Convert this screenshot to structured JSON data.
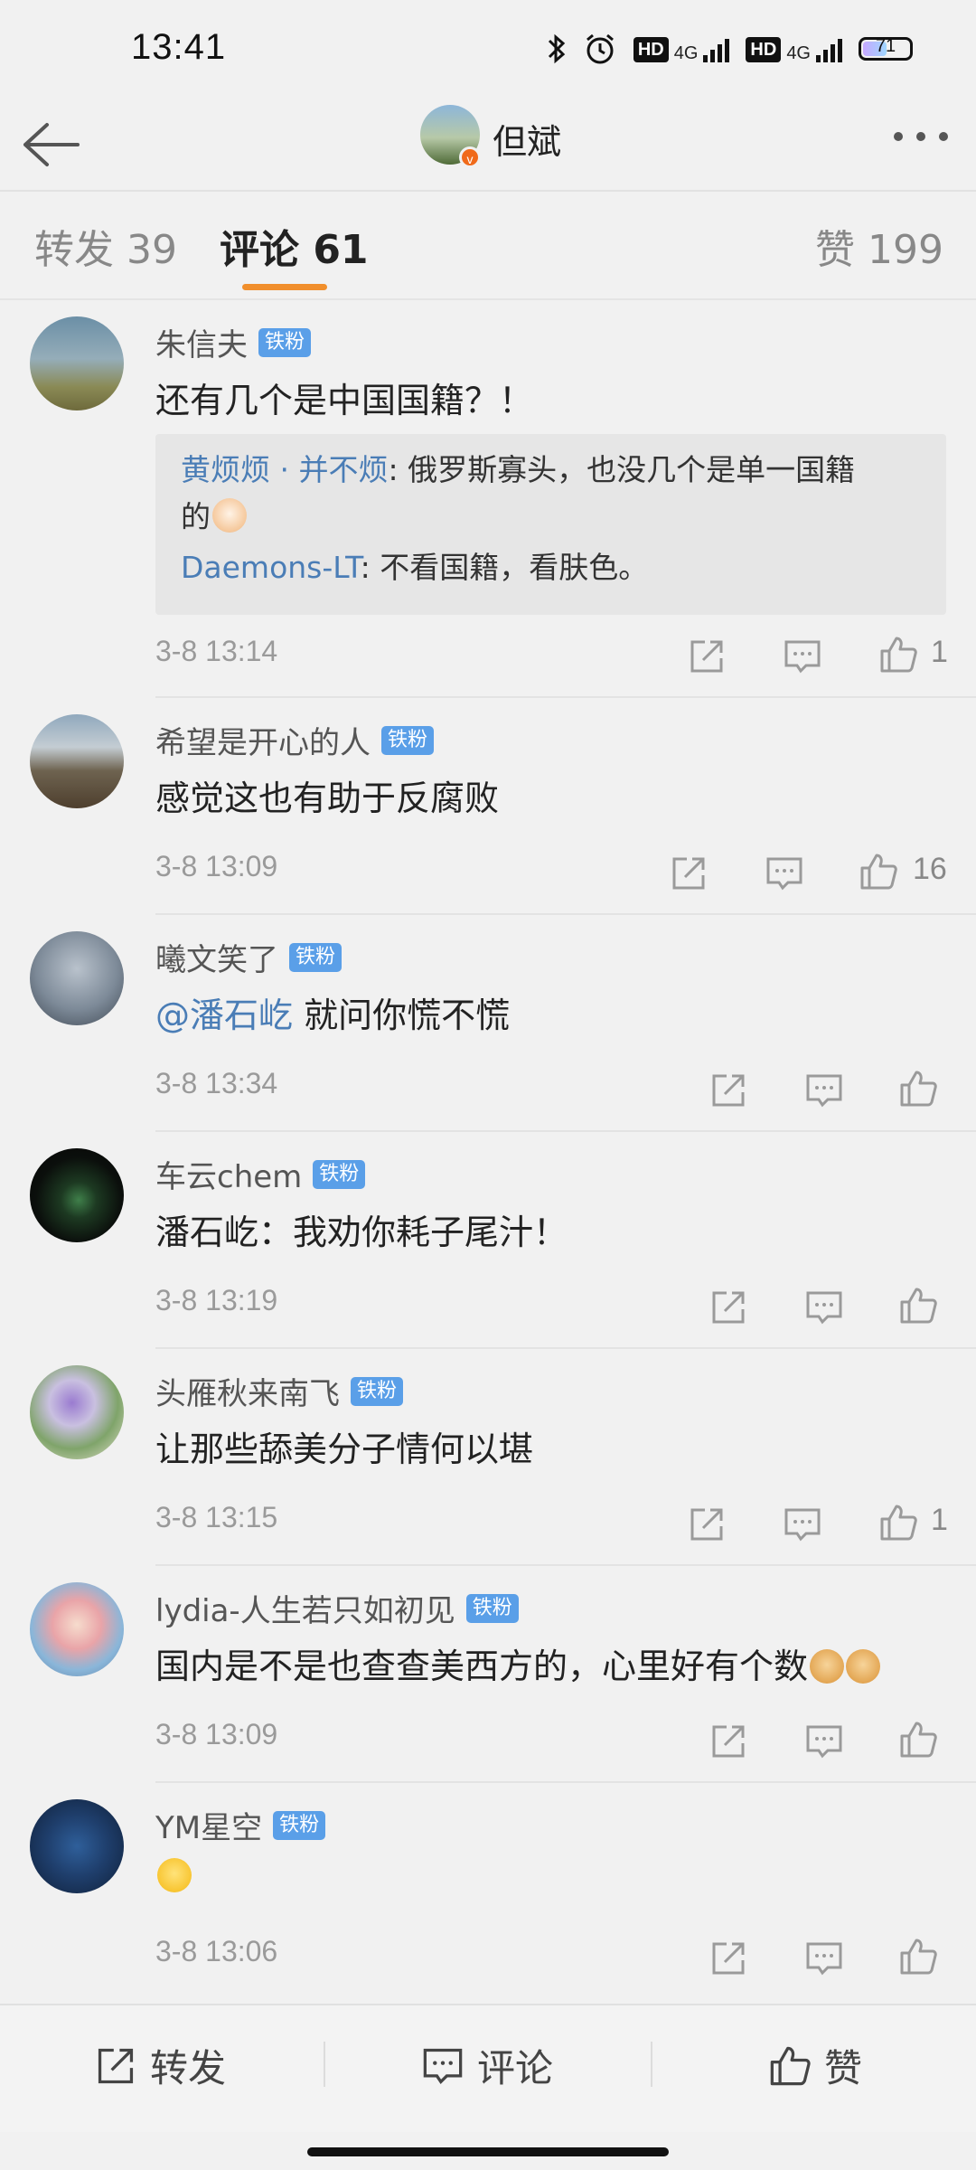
{
  "status_bar": {
    "time": "13:41",
    "hd_label": "HD",
    "network_label": "4G",
    "battery_level": "71"
  },
  "header": {
    "title": "但斌"
  },
  "tabs": {
    "repost_label": "转发 39",
    "comment_label": "评论 61",
    "like_label": "赞 199",
    "active": "评论 61"
  },
  "comments": [
    {
      "name": "朱信夫",
      "badge": "铁粉",
      "text": "还有几个是中国国籍？！",
      "replies": [
        {
          "name": "黄烦烦 · 并不烦",
          "sep": ":",
          "text": " 俄罗斯寡头，也没几个是单一国籍",
          "text2": "的"
        },
        {
          "name": "Daemons-LT",
          "sep": ":",
          "text": " 不看国籍，看肤色。"
        }
      ],
      "time": "3-8 13:14",
      "likes": "1"
    },
    {
      "name": "希望是开心的人",
      "badge": "铁粉",
      "text": "感觉这也有助于反腐败",
      "time": "3-8 13:09",
      "likes": "16"
    },
    {
      "name": "曦文笑了",
      "badge": "铁粉",
      "mention": "@潘石屹",
      "text": " 就问你慌不慌",
      "time": "3-8 13:34",
      "likes": ""
    },
    {
      "name": "车云chem",
      "badge": "铁粉",
      "text": "潘石屹：我劝你耗子尾汁！",
      "time": "3-8 13:19",
      "likes": ""
    },
    {
      "name": "头雁秋来南飞",
      "badge": "铁粉",
      "text": "让那些舔美分子情何以堪",
      "time": "3-8 13:15",
      "likes": "1"
    },
    {
      "name": "lydia-人生若只如初见",
      "badge": "铁粉",
      "text": "国内是不是也查查美西方的，心里好有个数",
      "time": "3-8 13:09",
      "likes": ""
    },
    {
      "name": "YM星空",
      "badge": "铁粉",
      "text": "",
      "time": "3-8 13:06",
      "likes": ""
    }
  ],
  "bottom_bar": {
    "repost": "转发",
    "comment": "评论",
    "like": "赞"
  },
  "colors": {
    "accent_orange": "#f18f2c",
    "badge_blue": "#5a9fe8",
    "link_blue": "#4a7db6"
  }
}
